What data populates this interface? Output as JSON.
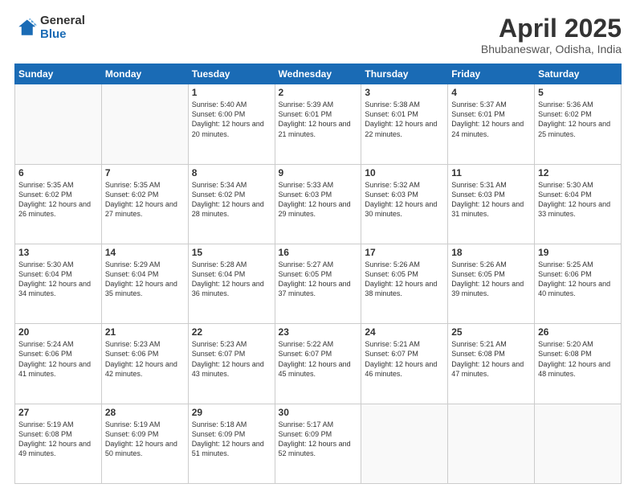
{
  "logo": {
    "general": "General",
    "blue": "Blue"
  },
  "header": {
    "title": "April 2025",
    "subtitle": "Bhubaneswar, Odisha, India"
  },
  "weekdays": [
    "Sunday",
    "Monday",
    "Tuesday",
    "Wednesday",
    "Thursday",
    "Friday",
    "Saturday"
  ],
  "weeks": [
    [
      {
        "day": "",
        "info": ""
      },
      {
        "day": "",
        "info": ""
      },
      {
        "day": "1",
        "info": "Sunrise: 5:40 AM\nSunset: 6:00 PM\nDaylight: 12 hours and 20 minutes."
      },
      {
        "day": "2",
        "info": "Sunrise: 5:39 AM\nSunset: 6:01 PM\nDaylight: 12 hours and 21 minutes."
      },
      {
        "day": "3",
        "info": "Sunrise: 5:38 AM\nSunset: 6:01 PM\nDaylight: 12 hours and 22 minutes."
      },
      {
        "day": "4",
        "info": "Sunrise: 5:37 AM\nSunset: 6:01 PM\nDaylight: 12 hours and 24 minutes."
      },
      {
        "day": "5",
        "info": "Sunrise: 5:36 AM\nSunset: 6:02 PM\nDaylight: 12 hours and 25 minutes."
      }
    ],
    [
      {
        "day": "6",
        "info": "Sunrise: 5:35 AM\nSunset: 6:02 PM\nDaylight: 12 hours and 26 minutes."
      },
      {
        "day": "7",
        "info": "Sunrise: 5:35 AM\nSunset: 6:02 PM\nDaylight: 12 hours and 27 minutes."
      },
      {
        "day": "8",
        "info": "Sunrise: 5:34 AM\nSunset: 6:02 PM\nDaylight: 12 hours and 28 minutes."
      },
      {
        "day": "9",
        "info": "Sunrise: 5:33 AM\nSunset: 6:03 PM\nDaylight: 12 hours and 29 minutes."
      },
      {
        "day": "10",
        "info": "Sunrise: 5:32 AM\nSunset: 6:03 PM\nDaylight: 12 hours and 30 minutes."
      },
      {
        "day": "11",
        "info": "Sunrise: 5:31 AM\nSunset: 6:03 PM\nDaylight: 12 hours and 31 minutes."
      },
      {
        "day": "12",
        "info": "Sunrise: 5:30 AM\nSunset: 6:04 PM\nDaylight: 12 hours and 33 minutes."
      }
    ],
    [
      {
        "day": "13",
        "info": "Sunrise: 5:30 AM\nSunset: 6:04 PM\nDaylight: 12 hours and 34 minutes."
      },
      {
        "day": "14",
        "info": "Sunrise: 5:29 AM\nSunset: 6:04 PM\nDaylight: 12 hours and 35 minutes."
      },
      {
        "day": "15",
        "info": "Sunrise: 5:28 AM\nSunset: 6:04 PM\nDaylight: 12 hours and 36 minutes."
      },
      {
        "day": "16",
        "info": "Sunrise: 5:27 AM\nSunset: 6:05 PM\nDaylight: 12 hours and 37 minutes."
      },
      {
        "day": "17",
        "info": "Sunrise: 5:26 AM\nSunset: 6:05 PM\nDaylight: 12 hours and 38 minutes."
      },
      {
        "day": "18",
        "info": "Sunrise: 5:26 AM\nSunset: 6:05 PM\nDaylight: 12 hours and 39 minutes."
      },
      {
        "day": "19",
        "info": "Sunrise: 5:25 AM\nSunset: 6:06 PM\nDaylight: 12 hours and 40 minutes."
      }
    ],
    [
      {
        "day": "20",
        "info": "Sunrise: 5:24 AM\nSunset: 6:06 PM\nDaylight: 12 hours and 41 minutes."
      },
      {
        "day": "21",
        "info": "Sunrise: 5:23 AM\nSunset: 6:06 PM\nDaylight: 12 hours and 42 minutes."
      },
      {
        "day": "22",
        "info": "Sunrise: 5:23 AM\nSunset: 6:07 PM\nDaylight: 12 hours and 43 minutes."
      },
      {
        "day": "23",
        "info": "Sunrise: 5:22 AM\nSunset: 6:07 PM\nDaylight: 12 hours and 45 minutes."
      },
      {
        "day": "24",
        "info": "Sunrise: 5:21 AM\nSunset: 6:07 PM\nDaylight: 12 hours and 46 minutes."
      },
      {
        "day": "25",
        "info": "Sunrise: 5:21 AM\nSunset: 6:08 PM\nDaylight: 12 hours and 47 minutes."
      },
      {
        "day": "26",
        "info": "Sunrise: 5:20 AM\nSunset: 6:08 PM\nDaylight: 12 hours and 48 minutes."
      }
    ],
    [
      {
        "day": "27",
        "info": "Sunrise: 5:19 AM\nSunset: 6:08 PM\nDaylight: 12 hours and 49 minutes."
      },
      {
        "day": "28",
        "info": "Sunrise: 5:19 AM\nSunset: 6:09 PM\nDaylight: 12 hours and 50 minutes."
      },
      {
        "day": "29",
        "info": "Sunrise: 5:18 AM\nSunset: 6:09 PM\nDaylight: 12 hours and 51 minutes."
      },
      {
        "day": "30",
        "info": "Sunrise: 5:17 AM\nSunset: 6:09 PM\nDaylight: 12 hours and 52 minutes."
      },
      {
        "day": "",
        "info": ""
      },
      {
        "day": "",
        "info": ""
      },
      {
        "day": "",
        "info": ""
      }
    ]
  ]
}
